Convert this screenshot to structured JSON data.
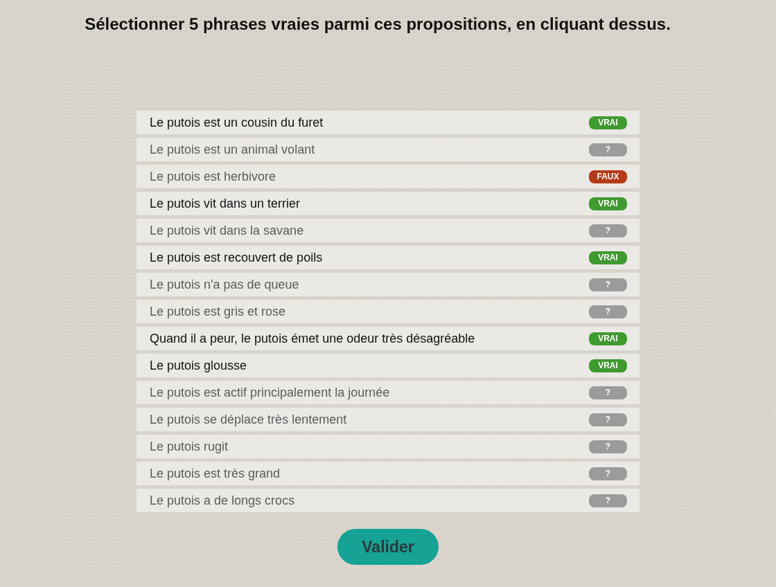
{
  "instruction": "Sélectionner 5 phrases vraies parmi ces propositions, en cliquant dessus.",
  "statements": [
    {
      "text": "Le putois est un cousin du furet",
      "selected": true,
      "badge": {
        "label": "VRAI",
        "kind": "true"
      }
    },
    {
      "text": "Le putois est un animal volant",
      "selected": false,
      "badge": {
        "label": "?",
        "kind": "unknown"
      }
    },
    {
      "text": "Le putois est herbivore",
      "selected": false,
      "badge": {
        "label": "FAUX",
        "kind": "false"
      }
    },
    {
      "text": "Le putois vit dans un terrier",
      "selected": true,
      "badge": {
        "label": "VRAI",
        "kind": "true"
      }
    },
    {
      "text": "Le putois vit dans la savane",
      "selected": false,
      "badge": {
        "label": "?",
        "kind": "unknown"
      }
    },
    {
      "text": "Le putois est recouvert de poils",
      "selected": true,
      "badge": {
        "label": "VRAI",
        "kind": "true"
      }
    },
    {
      "text": "Le putois n'a pas de queue",
      "selected": false,
      "badge": {
        "label": "?",
        "kind": "unknown"
      }
    },
    {
      "text": "Le putois est gris et rose",
      "selected": false,
      "badge": {
        "label": "?",
        "kind": "unknown"
      }
    },
    {
      "text": "Quand il a peur, le putois émet une odeur très désagréable",
      "selected": true,
      "badge": {
        "label": "VRAI",
        "kind": "true"
      }
    },
    {
      "text": "Le putois glousse",
      "selected": true,
      "badge": {
        "label": "VRAI",
        "kind": "true"
      }
    },
    {
      "text": "Le putois est actif principalement la journée",
      "selected": false,
      "badge": {
        "label": "?",
        "kind": "unknown"
      }
    },
    {
      "text": "Le putois se déplace très lentement",
      "selected": false,
      "badge": {
        "label": "?",
        "kind": "unknown"
      }
    },
    {
      "text": "Le putois rugit",
      "selected": false,
      "badge": {
        "label": "?",
        "kind": "unknown"
      }
    },
    {
      "text": "Le putois est très grand",
      "selected": false,
      "badge": {
        "label": "?",
        "kind": "unknown"
      }
    },
    {
      "text": "Le putois a de longs crocs",
      "selected": false,
      "badge": {
        "label": "?",
        "kind": "unknown"
      }
    }
  ],
  "submit_button": "Valider"
}
